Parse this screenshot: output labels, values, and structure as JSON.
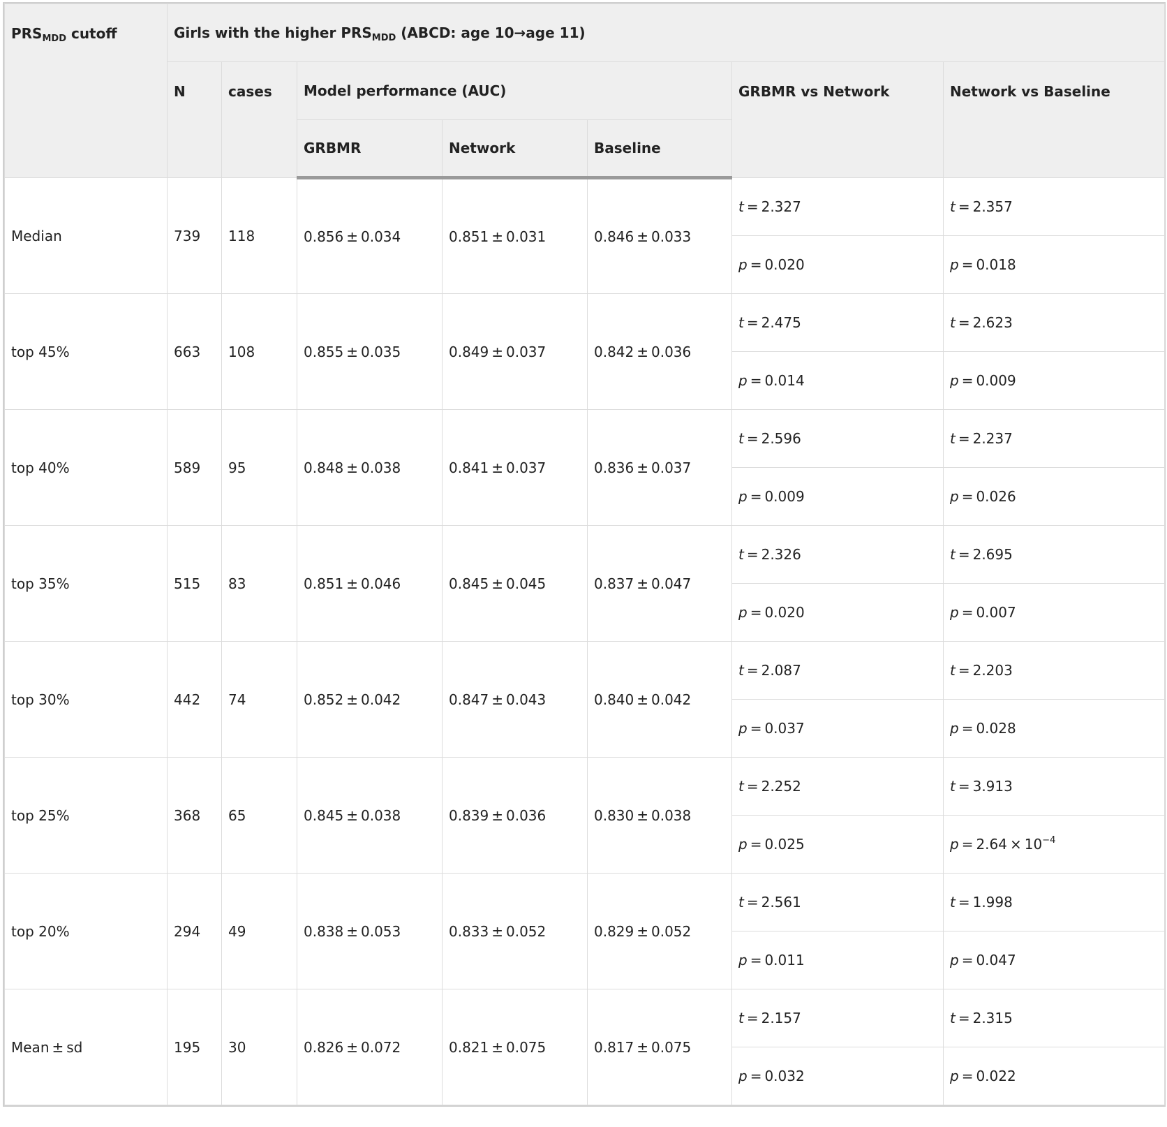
{
  "header": {
    "prs_col": {
      "pre": "PRS",
      "sub": "MDD",
      "post": " cutoff"
    },
    "group": {
      "pre": "Girls with the higher PRS",
      "sub": "MDD",
      "post": " (ABCD: age 10→age 11)"
    },
    "n": "N",
    "cases": "cases",
    "model_perf": "Model performance (AUC)",
    "grbmr_vs_network": "GRBMR vs Network",
    "network_vs_baseline": "Network vs Baseline",
    "grbmr": "GRBMR",
    "network": "Network",
    "baseline": "Baseline"
  },
  "rows": [
    {
      "cutoff": "Median",
      "n": "739",
      "cases": "118",
      "grbmr": "0.856 ± 0.034",
      "network": "0.851 ± 0.031",
      "baseline": "0.846 ± 0.033",
      "gn_t": {
        "l": "t",
        "v": " = 2.327"
      },
      "nb_t": {
        "l": "t",
        "v": " = 2.357"
      },
      "gn_p": {
        "l": "p",
        "v": " = 0.020"
      },
      "nb_p": {
        "l": "p",
        "v": " = 0.018"
      }
    },
    {
      "cutoff": "top 45%",
      "n": "663",
      "cases": "108",
      "grbmr": "0.855 ± 0.035",
      "network": "0.849 ± 0.037",
      "baseline": "0.842 ± 0.036",
      "gn_t": {
        "l": "t",
        "v": " = 2.475"
      },
      "nb_t": {
        "l": "t",
        "v": " = 2.623"
      },
      "gn_p": {
        "l": "p",
        "v": " = 0.014"
      },
      "nb_p": {
        "l": "p",
        "v": " = 0.009"
      }
    },
    {
      "cutoff": "top 40%",
      "n": "589",
      "cases": "95",
      "grbmr": "0.848 ± 0.038",
      "network": "0.841 ± 0.037",
      "baseline": "0.836 ± 0.037",
      "gn_t": {
        "l": "t",
        "v": " = 2.596"
      },
      "nb_t": {
        "l": "t",
        "v": " = 2.237"
      },
      "gn_p": {
        "l": "p",
        "v": " = 0.009"
      },
      "nb_p": {
        "l": "p",
        "v": " = 0.026"
      }
    },
    {
      "cutoff": "top 35%",
      "n": "515",
      "cases": "83",
      "grbmr": "0.851 ± 0.046",
      "network": "0.845 ± 0.045",
      "baseline": "0.837 ± 0.047",
      "gn_t": {
        "l": "t",
        "v": " = 2.326"
      },
      "nb_t": {
        "l": "t",
        "v": " = 2.695"
      },
      "gn_p": {
        "l": "p",
        "v": " = 0.020"
      },
      "nb_p": {
        "l": "p",
        "v": " = 0.007"
      }
    },
    {
      "cutoff": "top 30%",
      "n": "442",
      "cases": "74",
      "grbmr": "0.852 ± 0.042",
      "network": "0.847 ± 0.043",
      "baseline": "0.840 ± 0.042",
      "gn_t": {
        "l": "t",
        "v": " = 2.087"
      },
      "nb_t": {
        "l": "t",
        "v": " = 2.203"
      },
      "gn_p": {
        "l": "p",
        "v": " = 0.037"
      },
      "nb_p": {
        "l": "p",
        "v": " = 0.028"
      }
    },
    {
      "cutoff": "top 25%",
      "n": "368",
      "cases": "65",
      "grbmr": "0.845 ± 0.038",
      "network": "0.839 ± 0.036",
      "baseline": "0.830 ± 0.038",
      "gn_t": {
        "l": "t",
        "v": " = 2.252"
      },
      "nb_t": {
        "l": "t",
        "v": " = 3.913"
      },
      "gn_p": {
        "l": "p",
        "v": " = 0.025"
      },
      "nb_p": {
        "l": "p",
        "v": " = 2.64 × 10",
        "sup": "−4"
      }
    },
    {
      "cutoff": "top 20%",
      "n": "294",
      "cases": "49",
      "grbmr": "0.838 ± 0.053",
      "network": "0.833 ± 0.052",
      "baseline": "0.829 ± 0.052",
      "gn_t": {
        "l": "t",
        "v": " = 2.561"
      },
      "nb_t": {
        "l": "t",
        "v": " = 1.998"
      },
      "gn_p": {
        "l": "p",
        "v": " = 0.011"
      },
      "nb_p": {
        "l": "p",
        "v": " = 0.047"
      }
    },
    {
      "cutoff": "Mean ± sd",
      "n": "195",
      "cases": "30",
      "grbmr": "0.826 ± 0.072",
      "network": "0.821 ± 0.075",
      "baseline": "0.817 ± 0.075",
      "gn_t": {
        "l": "t",
        "v": " = 2.157"
      },
      "nb_t": {
        "l": "t",
        "v": " = 2.315"
      },
      "gn_p": {
        "l": "p",
        "v": " = 0.032"
      },
      "nb_p": {
        "l": "p",
        "v": " = 0.022"
      }
    }
  ]
}
